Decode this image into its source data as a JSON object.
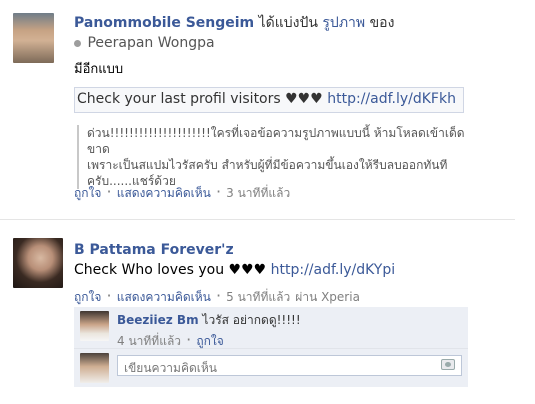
{
  "post1": {
    "author": "Panommobile Sengeim",
    "shared_prefix": "ได้แบ่งปัน",
    "shared_link": "รูปภาพ",
    "shared_suffix": "ของ",
    "original_owner": "Peerapan Wongpa",
    "message": "มีอีกแบบ",
    "link_text": "Check your last profil visitors ♥♥♥",
    "link_url": "http://adf.ly/dKFkh",
    "quote_line1": "ด่วน!!!!!!!!!!!!!!!!!!!!!ใครที่เจอข้อความรูปภาพแบบนี้ ห้ามโหลดเข้าเด็ดขาด",
    "quote_line2": "เพราะเป็นสแปมไวรัสครับ สำหรับผู้ที่มีข้อความขึ้นเองให้รีบลบออกทันที",
    "quote_line3": "ครับ......แชร์ด้วย",
    "like_label": "ถูกใจ",
    "comment_label": "แสดงความคิดเห็น",
    "time": "3 นาทีที่แล้ว"
  },
  "post2": {
    "author": "B Pattama Forever'z",
    "message_prefix": "Check Who loves you ♥♥♥",
    "link_url": "http://adf.ly/dKYpi",
    "like_label": "ถูกใจ",
    "comment_label": "แสดงความคิดเห็น",
    "time": "5 นาทีที่แล้ว",
    "via": "ผ่าน Xperia"
  },
  "comment": {
    "author": "Beeziiez Bm",
    "text": "ไวรัส อย่ากดดู!!!!!",
    "time": "4 นาทีที่แล้ว",
    "like_label": "ถูกใจ"
  },
  "composer": {
    "placeholder": "เขียนความคิดเห็น"
  },
  "separator": "·",
  "icons": {
    "share": "check-circle-icon",
    "camera": "camera-icon"
  }
}
